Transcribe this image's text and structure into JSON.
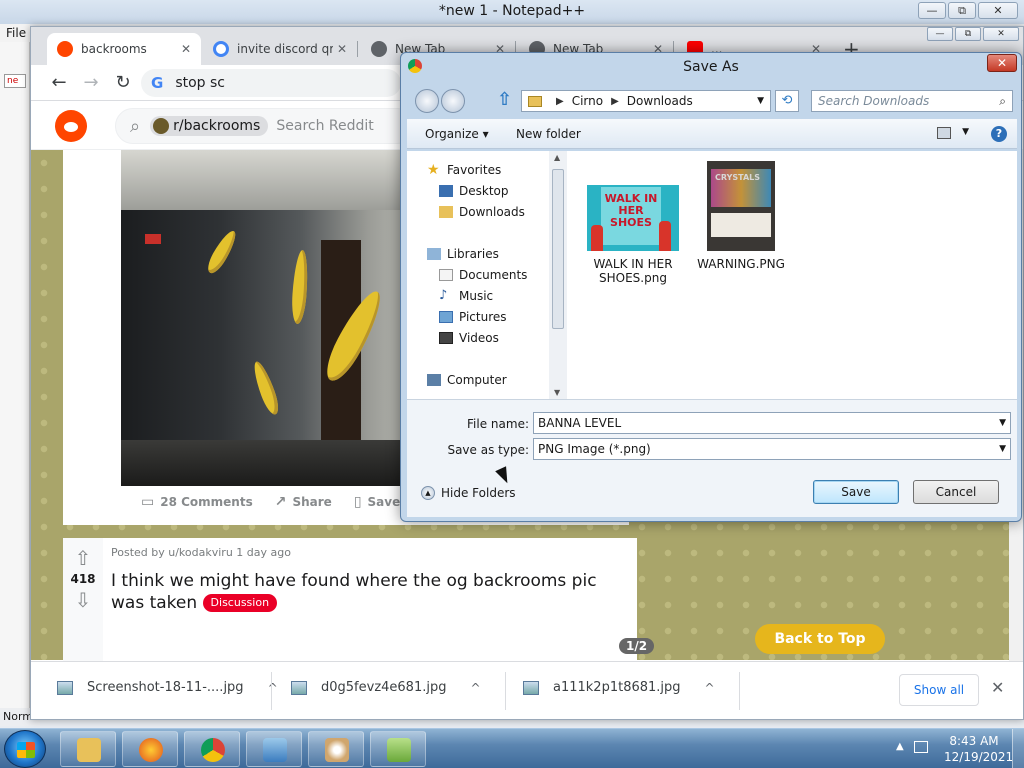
{
  "notepad": {
    "title": "*new 1 - Notepad++",
    "menu_file": "File",
    "tab_stub": "ne",
    "status": "Norm",
    "ctrl_min": "—",
    "ctrl_max": "⧉",
    "ctrl_close": "✕"
  },
  "chrome": {
    "tabs": [
      {
        "label": "backrooms",
        "close": "✕",
        "color": "#ff4500"
      },
      {
        "label": "invite discord qr",
        "close": "✕",
        "color": "#4285f4"
      },
      {
        "label": "New Tab",
        "close": "✕",
        "color": "#5f6368"
      },
      {
        "label": "New Tab",
        "close": "✕",
        "color": "#5f6368"
      },
      {
        "label": "...",
        "close": "✕",
        "color": "#ff0000"
      }
    ],
    "new_tab": "+",
    "omnibox_g": "G",
    "omnibox_text": "stop sc",
    "back": "←",
    "forward": "→",
    "reload": "↻"
  },
  "reddit": {
    "subreddit": "r/backrooms",
    "search_placeholder": "Search Reddit",
    "post1_actions": {
      "comments": "28 Comments",
      "share": "Share",
      "save": "Save",
      "more": "···"
    },
    "post2": {
      "votes": "418",
      "meta": "Posted by u/kodakviru 1 day ago",
      "title": "I think we might have found where the og backrooms pic was taken",
      "flair": "Discussion",
      "pager": "1/2"
    },
    "back_to_top": "Back to Top"
  },
  "downloads": {
    "items": [
      {
        "name": "Screenshot-18-11-....jpg"
      },
      {
        "name": "d0g5fevz4e681.jpg"
      },
      {
        "name": "a111k2p1t8681.jpg"
      }
    ],
    "chevron": "^",
    "show_all": "Show all",
    "close": "✕"
  },
  "dialog": {
    "title": "Save As",
    "close": "✕",
    "path": [
      "Cirno",
      "Downloads"
    ],
    "search_placeholder": "Search Downloads",
    "organize": "Organize ▾",
    "new_folder": "New folder",
    "help": "?",
    "nav": [
      {
        "label": "Favorites"
      },
      {
        "label": "Desktop"
      },
      {
        "label": "Downloads"
      },
      {
        "label": "Libraries"
      },
      {
        "label": "Documents"
      },
      {
        "label": "Music"
      },
      {
        "label": "Pictures"
      },
      {
        "label": "Videos"
      },
      {
        "label": "Computer"
      }
    ],
    "files": [
      {
        "name": "WALK IN HER SHOES.png",
        "thumb_text": "WALK IN HER SHOES"
      },
      {
        "name": "WARNING.PNG",
        "thumb_text": "CRYSTALS"
      }
    ],
    "file_name_label": "File name:",
    "file_name_value": "BANNA LEVEL",
    "save_type_label": "Save as type:",
    "save_type_value": "PNG Image (*.png)",
    "hide_folders": "Hide Folders",
    "save": "Save",
    "cancel": "Cancel"
  },
  "taskbar": {
    "time": "8:43 AM",
    "date": "12/19/2021"
  }
}
